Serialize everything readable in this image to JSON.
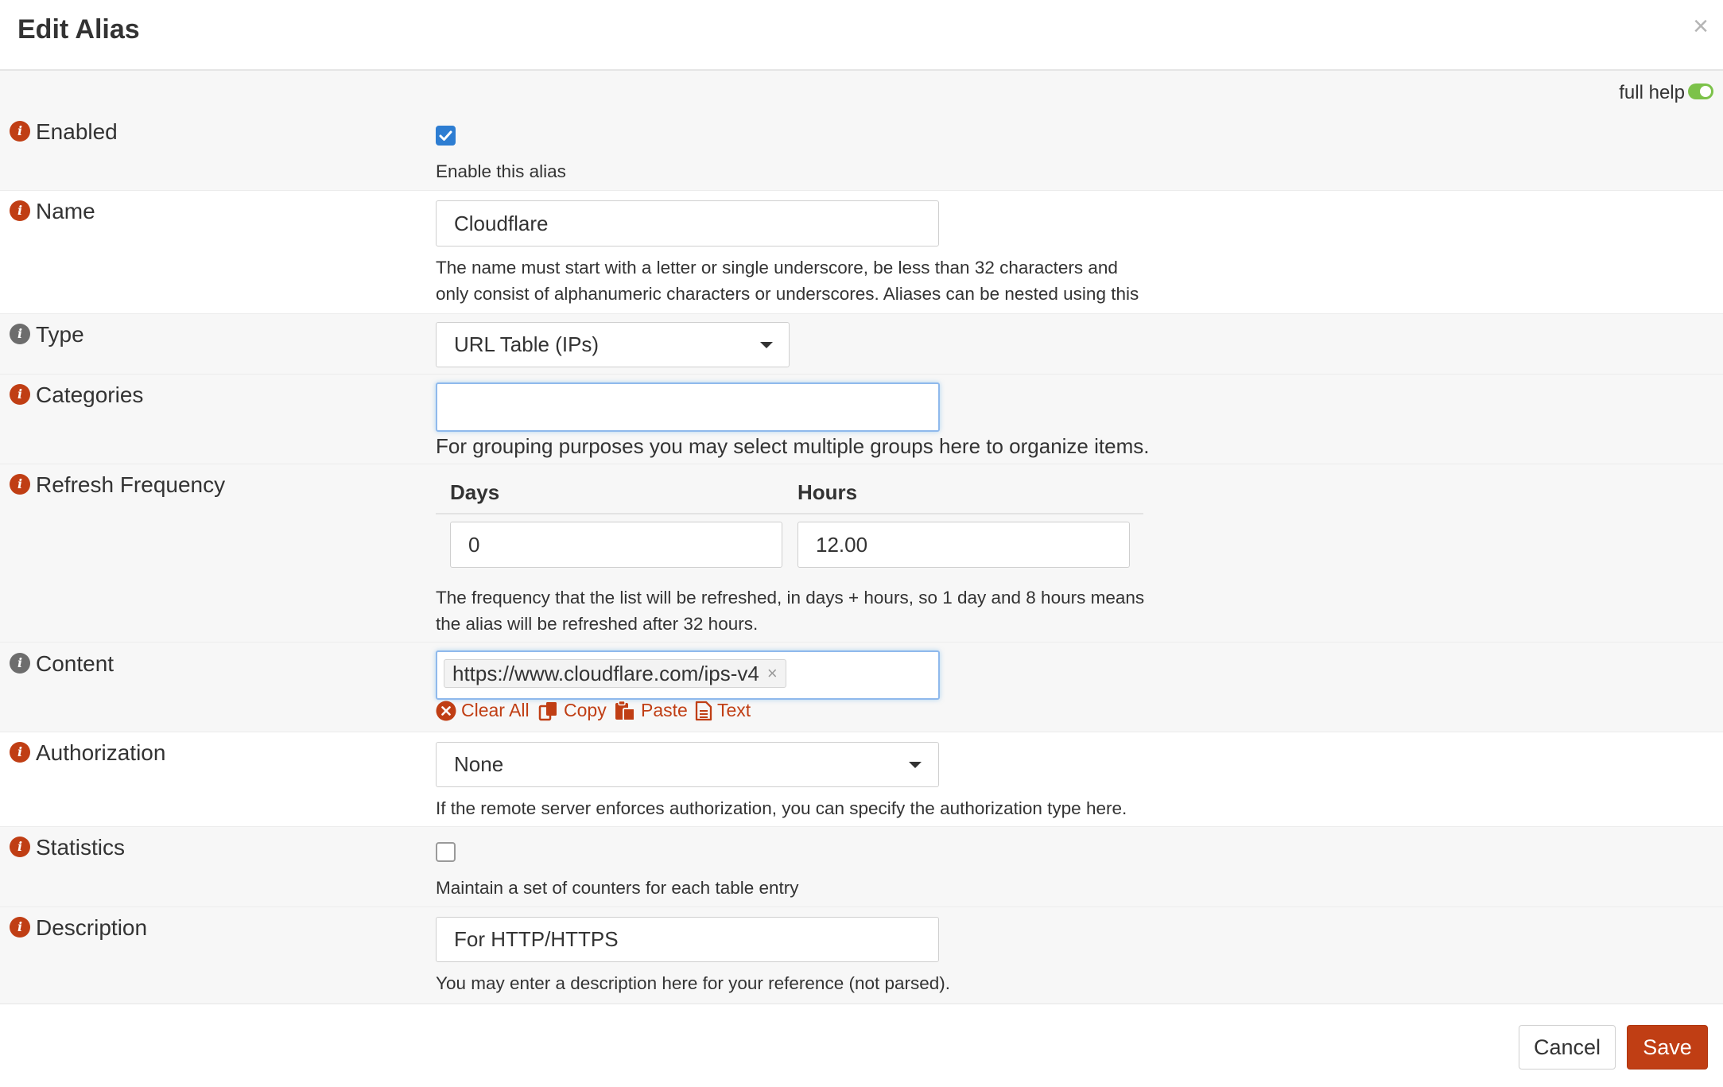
{
  "title": "Edit Alias",
  "full_help_label": "full help",
  "fields": {
    "enabled": {
      "label": "Enabled",
      "help": "Enable this alias",
      "checked": true
    },
    "name": {
      "label": "Name",
      "value": "Cloudflare",
      "help": "The name must start with a letter or single underscore, be less than 32 characters and only consist of alphanumeric characters or underscores. Aliases can be nested using this name."
    },
    "type": {
      "label": "Type",
      "value": "URL Table (IPs)"
    },
    "categories": {
      "label": "Categories",
      "value": "",
      "help": "For grouping purposes you may select multiple groups here to organize items."
    },
    "refresh": {
      "label": "Refresh Frequency",
      "days_header": "Days",
      "hours_header": "Hours",
      "days_value": "0",
      "hours_value": "12.00",
      "help": "The frequency that the list will be refreshed, in days + hours, so 1 day and 8 hours means the alias will be refreshed after 32 hours."
    },
    "content": {
      "label": "Content",
      "tags": [
        "https://www.cloudflare.com/ips-v4"
      ],
      "tools": {
        "clear_all": "Clear All",
        "copy": "Copy",
        "paste": "Paste",
        "text": "Text"
      }
    },
    "authorization": {
      "label": "Authorization",
      "value": "None",
      "help": "If the remote server enforces authorization, you can specify the authorization type here."
    },
    "statistics": {
      "label": "Statistics",
      "help": "Maintain a set of counters for each table entry",
      "checked": false
    },
    "description": {
      "label": "Description",
      "value": "For HTTP/HTTPS",
      "help": "You may enter a description here for your reference (not parsed)."
    }
  },
  "buttons": {
    "cancel": "Cancel",
    "save": "Save"
  },
  "colors": {
    "accent": "#c03e14",
    "checkbox_on": "#2d7dd2",
    "toggle_on": "#7cc24a",
    "info_grey": "#6d6d6d"
  }
}
